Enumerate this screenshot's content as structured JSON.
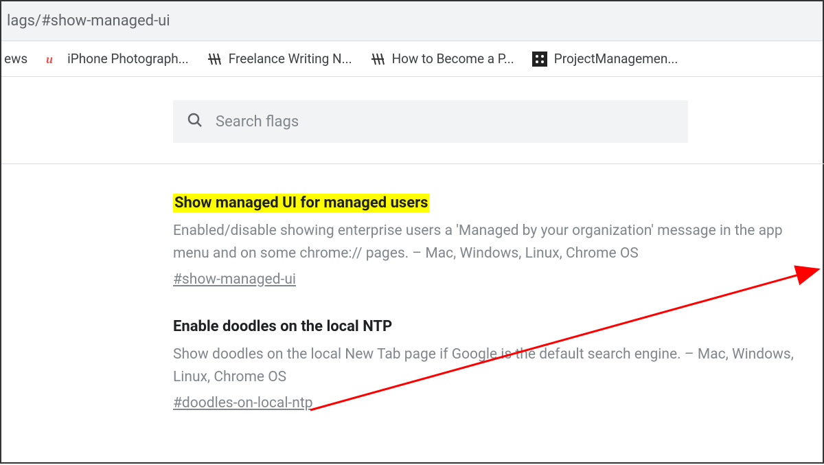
{
  "url": {
    "prefix": "lags/",
    "hash": "#show-managed-ui"
  },
  "bookmarks": [
    {
      "label": "ews",
      "icon": "generic"
    },
    {
      "label": "iPhone Photograph...",
      "icon": "udemy"
    },
    {
      "label": "Freelance Writing N...",
      "icon": "hash"
    },
    {
      "label": "How to Become a P...",
      "icon": "hash"
    },
    {
      "label": "ProjectManagemen...",
      "icon": "pm"
    }
  ],
  "search": {
    "placeholder": "Search flags"
  },
  "flags": [
    {
      "title": "Show managed UI for managed users",
      "highlighted": true,
      "description": "Enabled/disable showing enterprise users a 'Managed by your organization' message in the app menu and on some chrome:// pages. – Mac, Windows, Linux, Chrome OS",
      "anchor": "#show-managed-ui"
    },
    {
      "title": "Enable doodles on the local NTP",
      "highlighted": false,
      "description": "Show doodles on the local New Tab page if Google is the default search engine. – Mac, Windows, Linux, Chrome OS",
      "anchor": "#doodles-on-local-ntp"
    }
  ]
}
